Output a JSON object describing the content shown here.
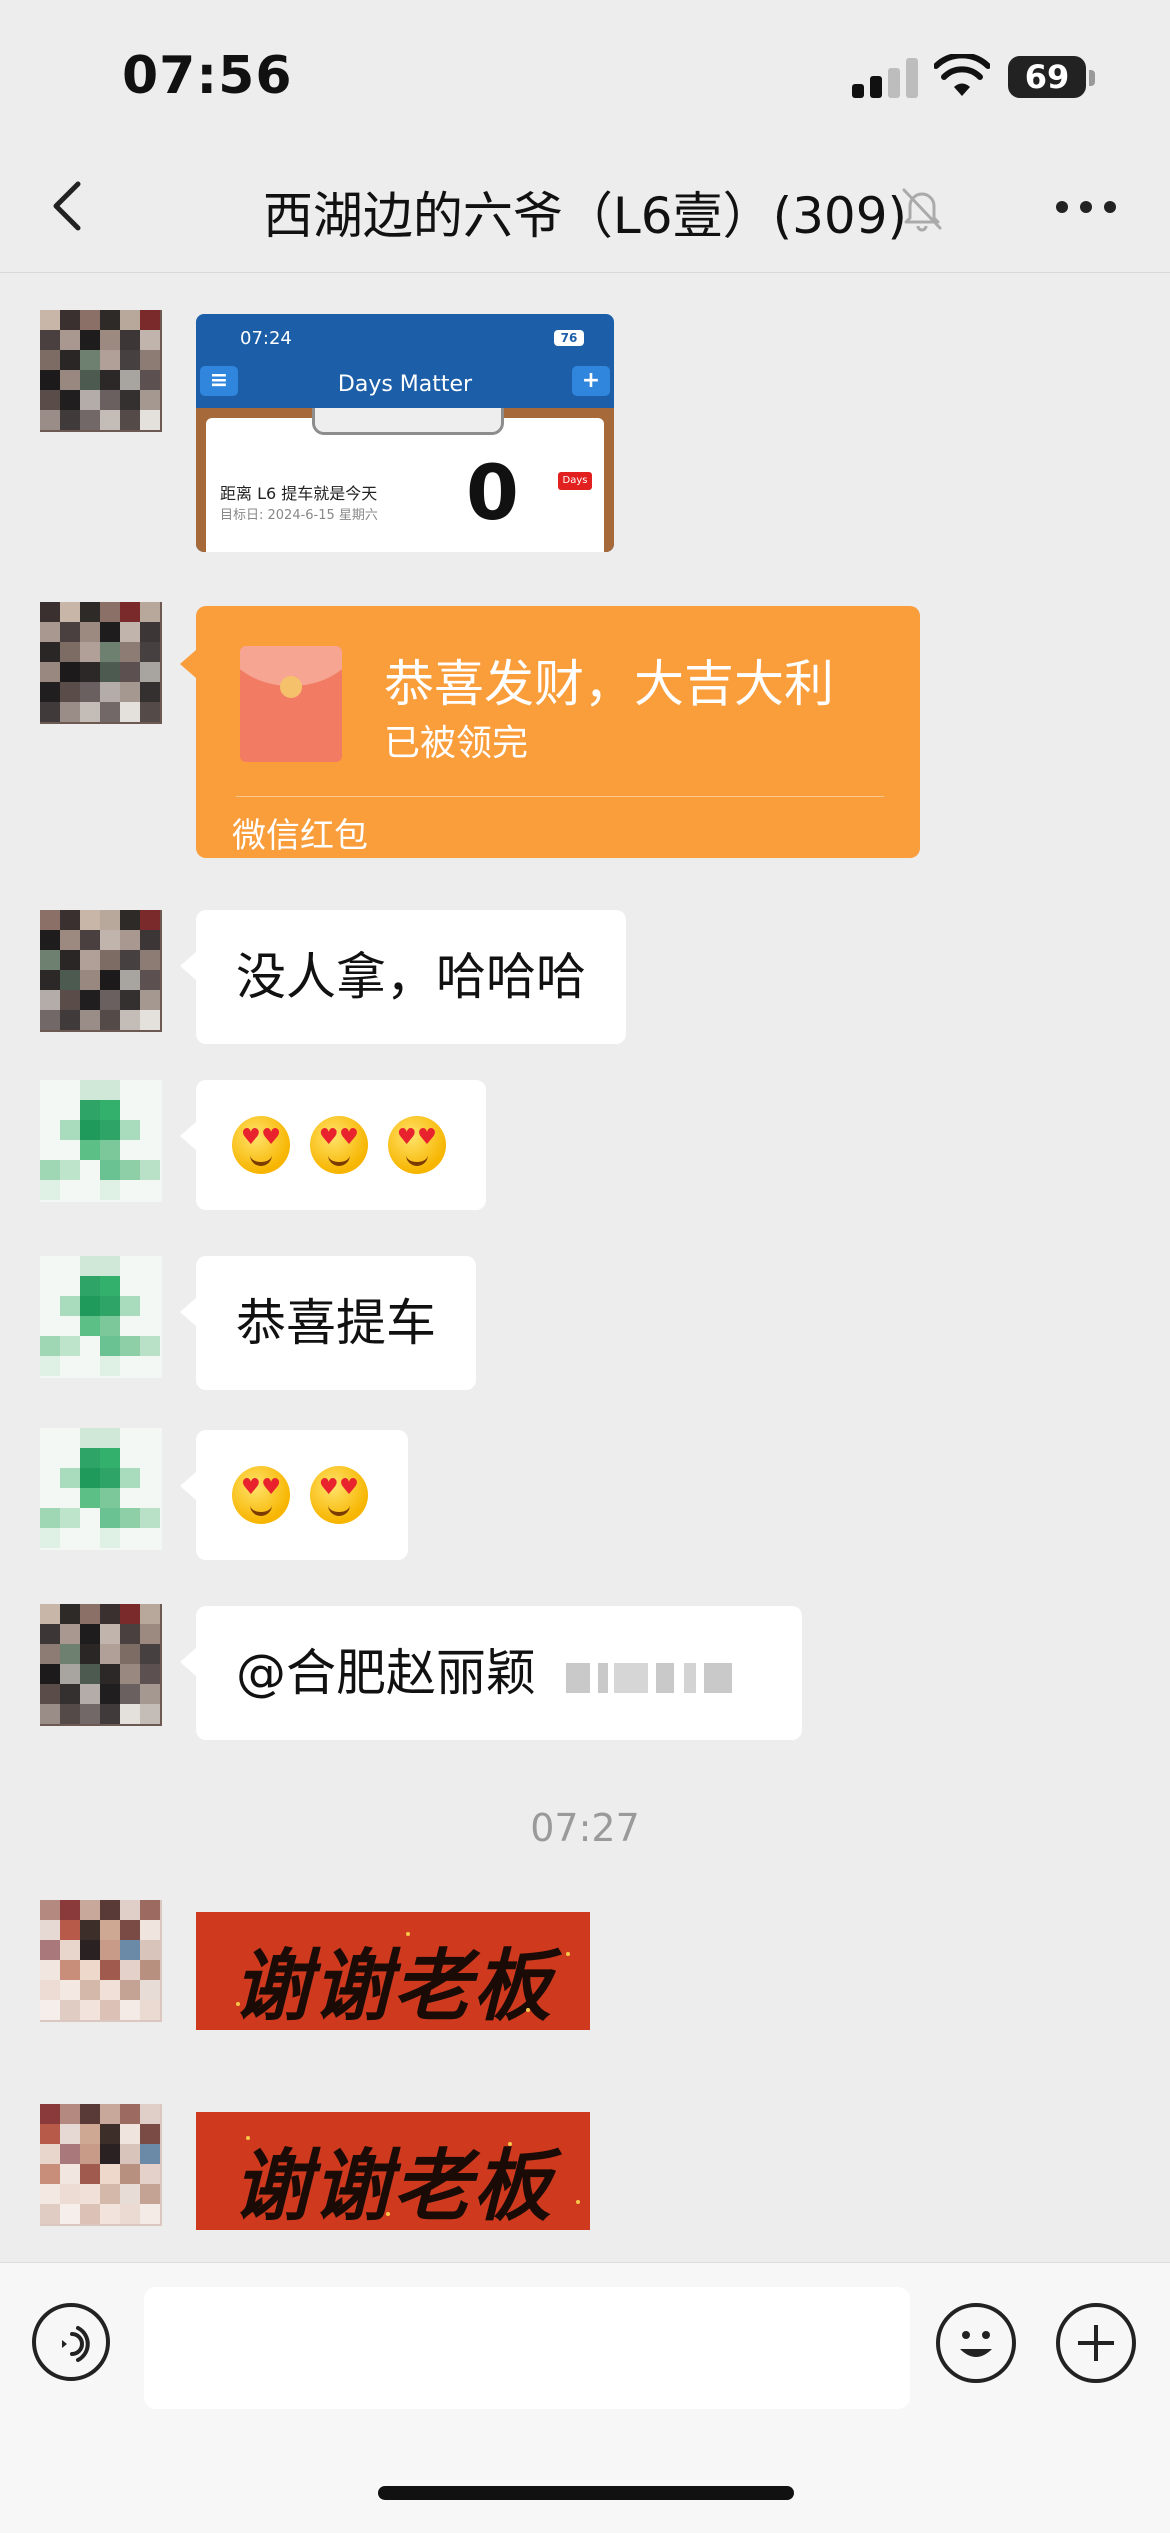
{
  "status_bar": {
    "time": "07:56",
    "battery": "69"
  },
  "nav": {
    "title": "西湖边的六爷（L6壹）(309)"
  },
  "messages": {
    "screenshot": {
      "time": "07:24",
      "battery": "76",
      "app_title": "Days Matter",
      "menu_glyph": "≡",
      "add_glyph": "+",
      "event": "距离 L6 提车就是今天",
      "target": "目标日: 2024-6-15 星期六",
      "days": "0",
      "days_tag": "Days"
    },
    "red_packet": {
      "title": "恭喜发财，大吉大利",
      "status": "已被领完",
      "footer": "微信红包"
    },
    "text1": "没人拿，哈哈哈",
    "text2": "恭喜提车",
    "text3_prefix": "@合肥赵丽颖",
    "timestamp": "07:27",
    "sticker": "谢谢老板"
  }
}
